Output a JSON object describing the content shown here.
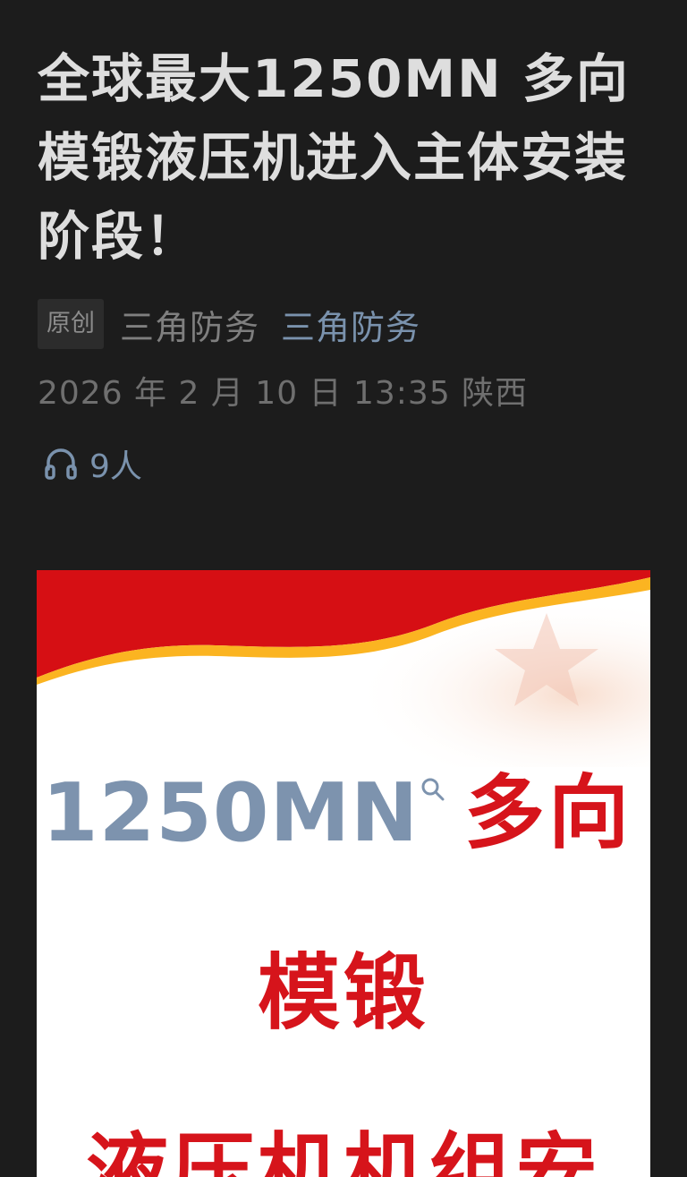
{
  "article": {
    "title": "全球最大1250MN 多向模锻液压机进入主体安装阶段！",
    "tag": "原创",
    "author": "三角防务",
    "account": "三角防务",
    "datetime": "2026 年 2 月 10 日  13:35  陕西",
    "listeners": "9人"
  },
  "icons": {
    "listen": "headphones-icon",
    "search": "search-icon"
  },
  "image": {
    "line1_number": "1250MN",
    "line1_text": "多向",
    "line2_text": "模锻",
    "line3_text": "液压机机组安"
  },
  "colors": {
    "background": "#1c1c1c",
    "link": "#7a92ad",
    "banner_red": "#d60f14",
    "banner_yellow": "#fbb421",
    "image_red_text": "#d6141b",
    "image_blue_text": "#7d93ae"
  }
}
